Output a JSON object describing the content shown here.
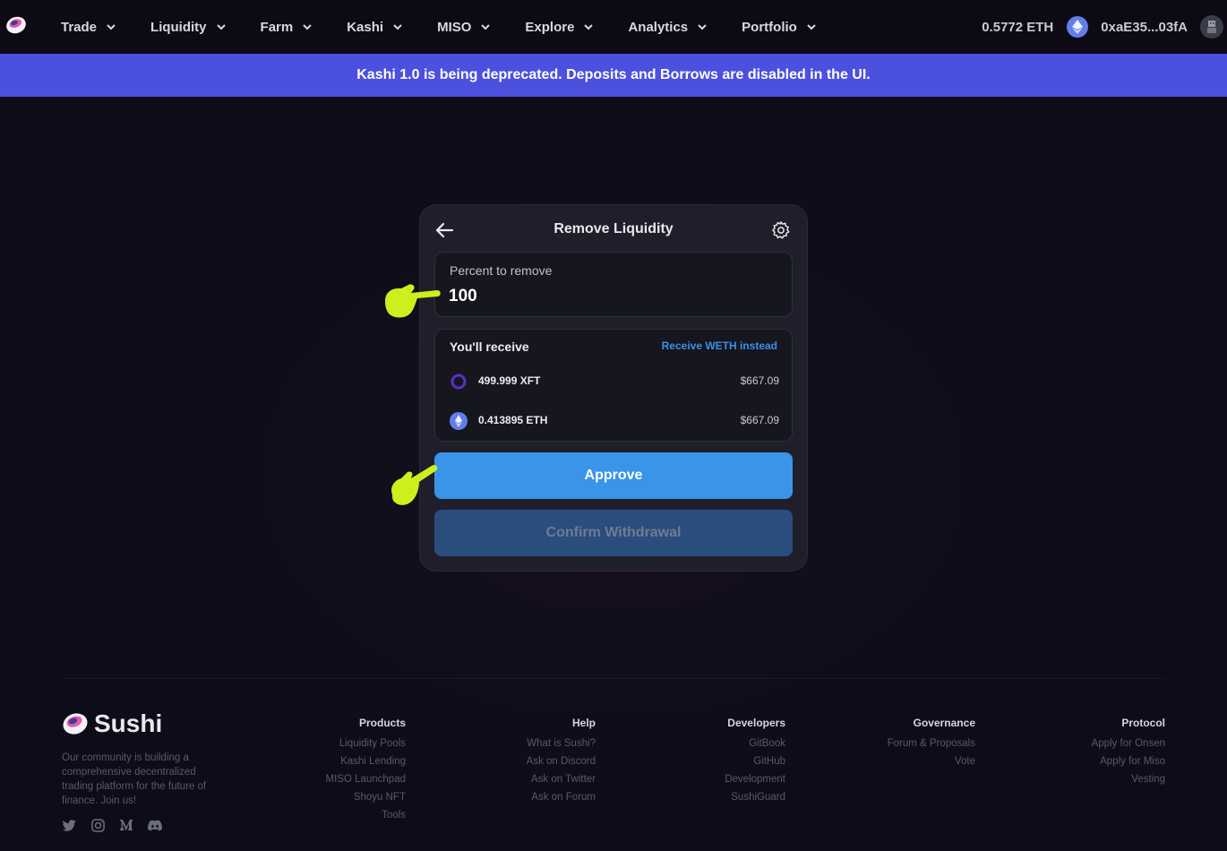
{
  "nav": {
    "items": [
      {
        "label": "Trade"
      },
      {
        "label": "Liquidity"
      },
      {
        "label": "Farm"
      },
      {
        "label": "Kashi"
      },
      {
        "label": "MISO"
      },
      {
        "label": "Explore"
      },
      {
        "label": "Analytics"
      },
      {
        "label": "Portfolio"
      }
    ],
    "balance": "0.5772 ETH",
    "account": "0xaE35...03fA"
  },
  "banner": {
    "text": "Kashi 1.0 is being deprecated. Deposits and Borrows are disabled in the UI."
  },
  "card": {
    "title": "Remove Liquidity",
    "percent_label": "Percent to remove",
    "percent_value": "100",
    "receive_title": "You'll receive",
    "weth_link": "Receive WETH instead",
    "tokens": [
      {
        "amount": "499.999 XFT",
        "usd": "$667.09",
        "icon": "xft-token-icon"
      },
      {
        "amount": "0.413895 ETH",
        "usd": "$667.09",
        "icon": "eth-token-icon"
      }
    ],
    "approve_label": "Approve",
    "confirm_label": "Confirm Withdrawal"
  },
  "footer": {
    "brand": "Sushi",
    "tagline": "Our community is building a comprehensive decentralized trading platform for the future of finance. Join us!",
    "columns": [
      {
        "heading": "Products",
        "links": [
          "Liquidity Pools",
          "Kashi Lending",
          "MISO Launchpad",
          "Shoyu NFT",
          "Tools"
        ]
      },
      {
        "heading": "Help",
        "links": [
          "What is Sushi?",
          "Ask on Discord",
          "Ask on Twitter",
          "Ask on Forum"
        ]
      },
      {
        "heading": "Developers",
        "links": [
          "GitBook",
          "GitHub",
          "Development",
          "SushiGuard"
        ]
      },
      {
        "heading": "Governance",
        "links": [
          "Forum & Proposals",
          "Vote"
        ]
      },
      {
        "heading": "Protocol",
        "links": [
          "Apply for Onsen",
          "Apply for Miso",
          "Vesting"
        ]
      }
    ],
    "socials": [
      "twitter-icon",
      "instagram-icon",
      "medium-icon",
      "discord-icon"
    ]
  },
  "colors": {
    "banner": "#4c50de",
    "approve": "#3a95e8",
    "confirm": "#2a4d7d",
    "link": "#3f8ee6",
    "hand": "#ccf01d"
  }
}
